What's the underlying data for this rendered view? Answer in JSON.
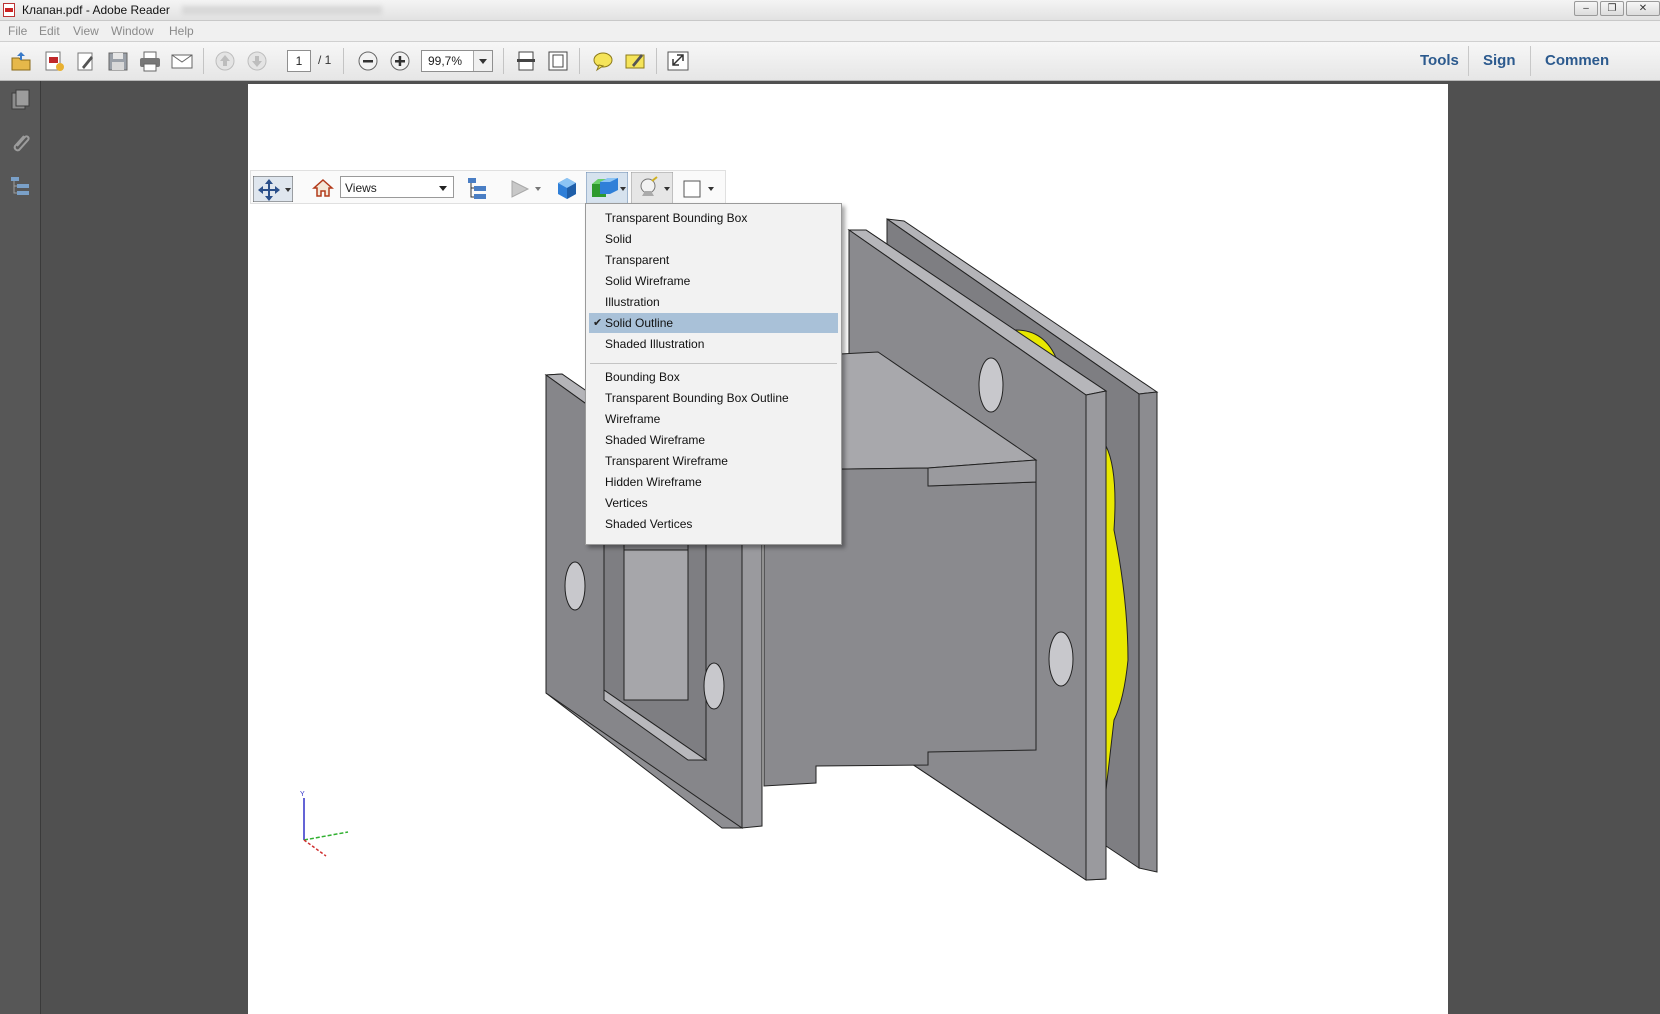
{
  "window": {
    "title": "Клапан.pdf - Adobe Reader"
  },
  "menubar": [
    "File",
    "Edit",
    "View",
    "Window",
    "Help"
  ],
  "toolbar": {
    "page_current": "1",
    "page_total": "/ 1",
    "zoom": "99,7%",
    "right_links": [
      "Tools",
      "Sign",
      "Commen"
    ]
  },
  "tool3d": {
    "views_label": "Views"
  },
  "render_menu": {
    "group1": [
      "Transparent Bounding Box",
      "Solid",
      "Transparent",
      "Solid Wireframe",
      "Illustration",
      "Solid Outline",
      "Shaded Illustration"
    ],
    "selected": "Solid Outline",
    "group2": [
      "Bounding Box",
      "Transparent Bounding Box Outline",
      "Wireframe",
      "Shaded Wireframe",
      "Transparent Wireframe",
      "Hidden Wireframe",
      "Vertices",
      "Shaded Vertices"
    ]
  },
  "axes": {
    "label": "Y"
  },
  "colors": {
    "model_face": "#8a8a8e",
    "model_light": "#a3a3a7",
    "model_dark": "#6e6e72",
    "highlight": "#e8e800",
    "menu_select": "#a9c1d8"
  }
}
